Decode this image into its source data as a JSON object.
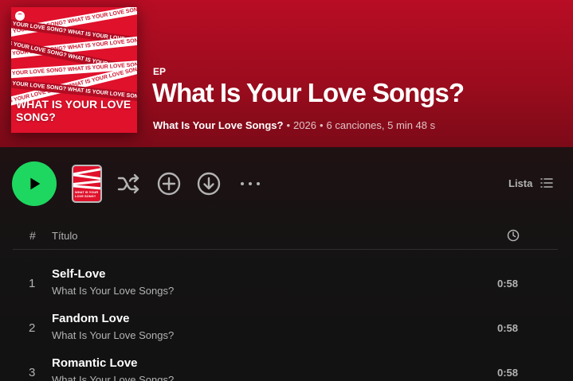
{
  "album": {
    "type": "EP",
    "title": "What Is Your Love Songs?",
    "artist": "What Is Your Love Songs?",
    "year": "2026",
    "summary": "6 canciones, 5 min 48 s",
    "separator": "•",
    "cover_text": "WHAT IS YOUR LOVE SONG?",
    "cover_band_text": "WHAT IS YOUR LOVE SONG? WHAT IS YOUR LOVE SONG? WHAT IS YOUR LOVE SONG?",
    "mini_cover_text": "WHAT IS YOUR LOVE SONG?",
    "colors": {
      "header": "#b80d24",
      "play": "#1ed760",
      "cover": "#e0112b"
    }
  },
  "controls": {
    "play_icon": "play-icon",
    "shuffle_icon": "shuffle-icon",
    "add_icon": "add-circle-icon",
    "download_icon": "download-icon",
    "more_icon": "more-horizontal-icon",
    "view_label": "Lista",
    "view_icon": "list-view-icon"
  },
  "table": {
    "col_num": "#",
    "col_title": "Título",
    "col_duration_icon": "clock-icon"
  },
  "tracks": [
    {
      "num": "1",
      "name": "Self-Love",
      "artist": "What Is Your Love Songs?",
      "duration": "0:58"
    },
    {
      "num": "2",
      "name": "Fandom Love",
      "artist": "What Is Your Love Songs?",
      "duration": "0:58"
    },
    {
      "num": "3",
      "name": "Romantic Love",
      "artist": "What Is Your Love Songs?",
      "duration": "0:58"
    }
  ]
}
